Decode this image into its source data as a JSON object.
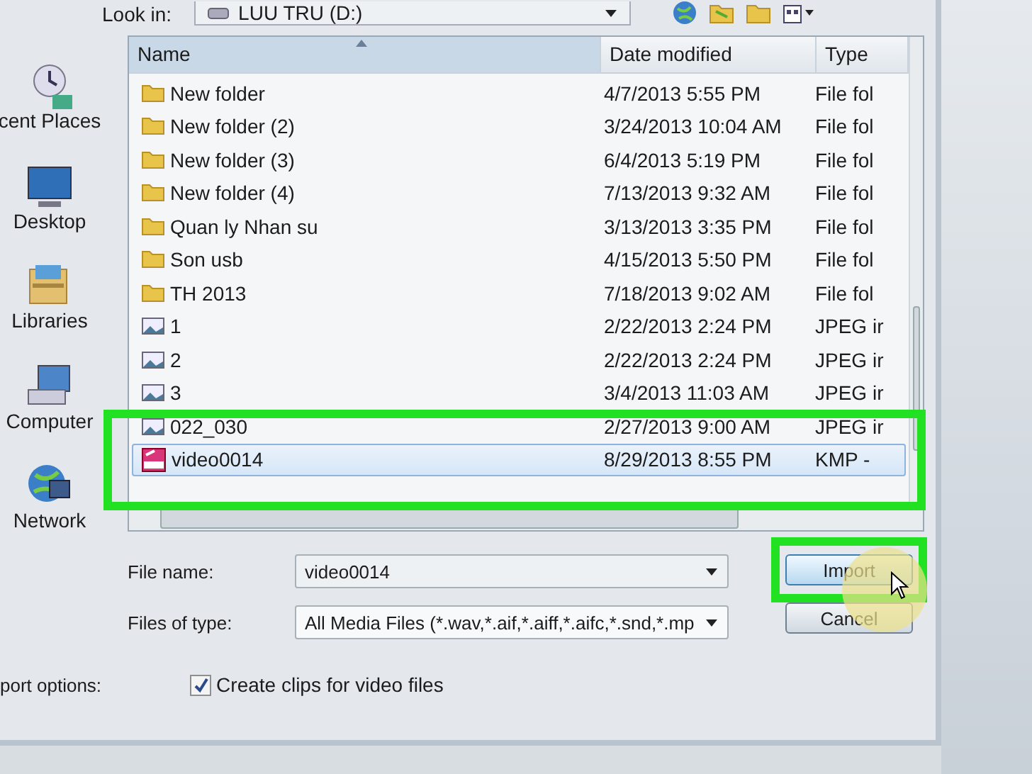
{
  "look_in": {
    "label": "Look in:",
    "value": "LUU TRU (D:)"
  },
  "sidebar": {
    "items": [
      {
        "label": "cent Places",
        "kind": "recent",
        "selected": false
      },
      {
        "label": "Desktop",
        "kind": "desktop",
        "selected": false
      },
      {
        "label": "Libraries",
        "kind": "libraries",
        "selected": false
      },
      {
        "label": "Computer",
        "kind": "computer",
        "selected": false
      },
      {
        "label": "Network",
        "kind": "network",
        "selected": false
      }
    ]
  },
  "file_list": {
    "columns": [
      "Name",
      "Date modified",
      "Type"
    ],
    "rows": [
      {
        "name": "New folder",
        "date": "4/7/2013 5:55 PM",
        "type": "File fol",
        "kind": "folder",
        "selected": false
      },
      {
        "name": "New folder (2)",
        "date": "3/24/2013 10:04 AM",
        "type": "File fol",
        "kind": "folder",
        "selected": false
      },
      {
        "name": "New folder (3)",
        "date": "6/4/2013 5:19 PM",
        "type": "File fol",
        "kind": "folder",
        "selected": false
      },
      {
        "name": "New folder (4)",
        "date": "7/13/2013 9:32 AM",
        "type": "File fol",
        "kind": "folder",
        "selected": false
      },
      {
        "name": "Quan ly Nhan su",
        "date": "3/13/2013 3:35 PM",
        "type": "File fol",
        "kind": "folder",
        "selected": false
      },
      {
        "name": "Son usb",
        "date": "4/15/2013 5:50 PM",
        "type": "File fol",
        "kind": "folder",
        "selected": false
      },
      {
        "name": "TH 2013",
        "date": "7/18/2013 9:02 AM",
        "type": "File fol",
        "kind": "folder",
        "selected": false
      },
      {
        "name": "1",
        "date": "2/22/2013 2:24 PM",
        "type": "JPEG ir",
        "kind": "image",
        "selected": false
      },
      {
        "name": "2",
        "date": "2/22/2013 2:24 PM",
        "type": "JPEG ir",
        "kind": "image",
        "selected": false
      },
      {
        "name": "3",
        "date": "3/4/2013 11:03 AM",
        "type": "JPEG ir",
        "kind": "image",
        "selected": false
      },
      {
        "name": "022_030",
        "date": "2/27/2013 9:00 AM",
        "type": "JPEG ir",
        "kind": "image",
        "selected": false
      },
      {
        "name": "video0014",
        "date": "8/29/2013 8:55 PM",
        "type": "KMP -",
        "kind": "video",
        "selected": true
      }
    ]
  },
  "file_name": {
    "label": "File name:",
    "value": "video0014"
  },
  "files_of_type": {
    "label": "Files of type:",
    "value": "All Media Files (*.wav,*.aif,*.aiff,*.aifc,*.snd,*.mp"
  },
  "options": {
    "label": "port options:",
    "checkbox": {
      "label": "Create clips for video files",
      "checked": true
    }
  },
  "buttons": [
    {
      "label": "Import",
      "highlighted": true
    },
    {
      "label": "Cancel",
      "highlighted": false
    }
  ]
}
